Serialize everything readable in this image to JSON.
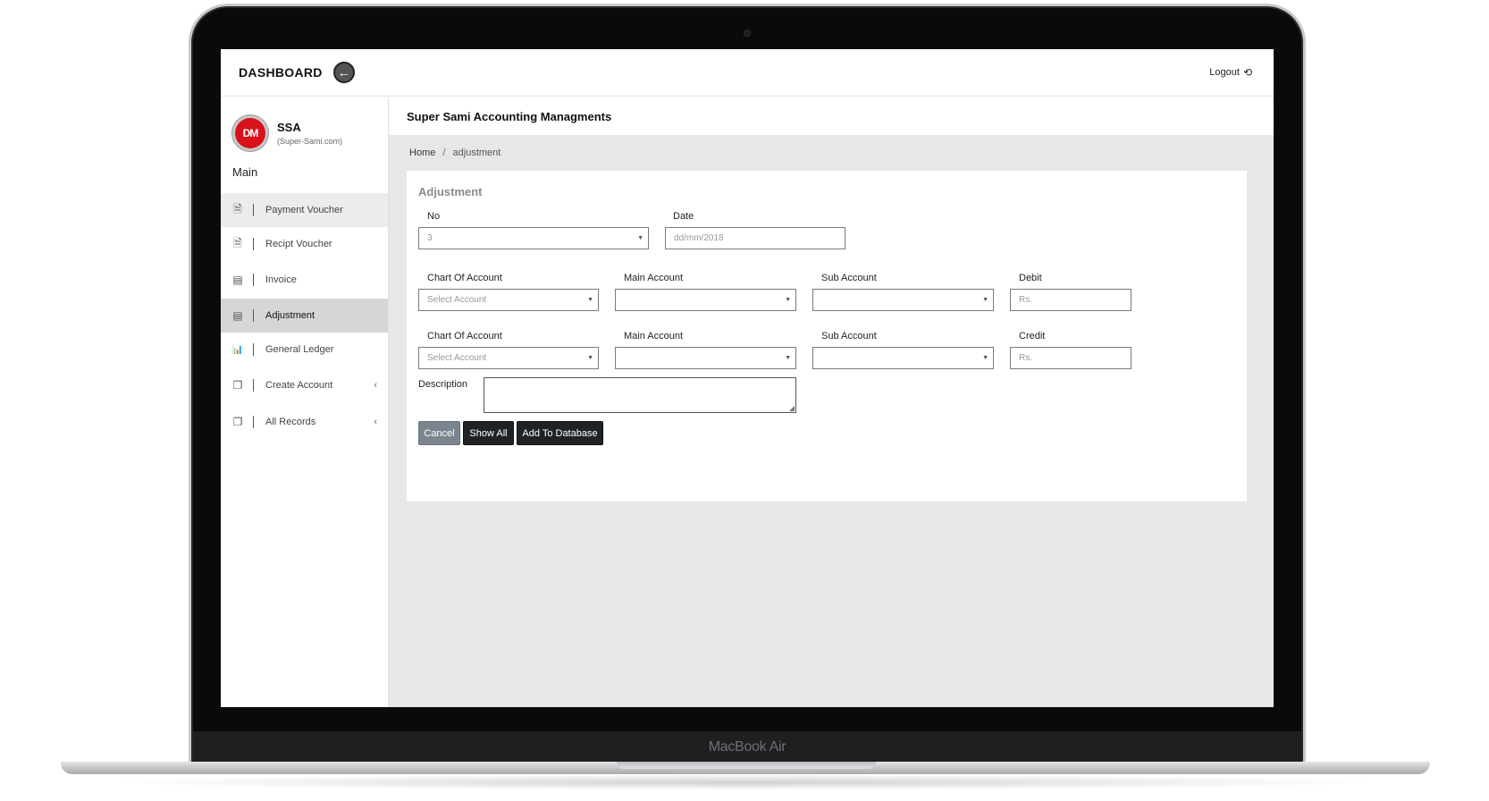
{
  "device": {
    "label": "MacBook Air"
  },
  "topbar": {
    "title": "DASHBOARD",
    "back_icon": "←",
    "logout_label": "Logout",
    "logout_icon": "⟲"
  },
  "profile": {
    "avatar_text": "DM",
    "name": "SSA",
    "subtitle": "(Super-Sami.com)"
  },
  "sidebar": {
    "section_title": "Main",
    "items": [
      {
        "label": "Payment Voucher",
        "icon": "🗎",
        "icon_name": "document-icon",
        "chevron": ""
      },
      {
        "label": "Recipt Voucher",
        "icon": "🗎",
        "icon_name": "document-icon",
        "chevron": ""
      },
      {
        "label": "Invoice",
        "icon": "▤",
        "icon_name": "clipboard-icon",
        "chevron": ""
      },
      {
        "label": "Adjustment",
        "icon": "▤",
        "icon_name": "clipboard-icon",
        "chevron": ""
      },
      {
        "label": "General Ledger",
        "icon": "📊",
        "icon_name": "bar-chart-icon",
        "chevron": ""
      },
      {
        "label": "Create Account",
        "icon": "❐",
        "icon_name": "copy-icon",
        "chevron": "‹"
      },
      {
        "label": "All Records",
        "icon": "❐",
        "icon_name": "copy-icon",
        "chevron": "‹"
      }
    ]
  },
  "content": {
    "header_title": "Super Sami Accounting Managments",
    "breadcrumb": {
      "home": "Home",
      "separator": "/",
      "current": "adjustment"
    }
  },
  "form": {
    "title": "Adjustment",
    "no": {
      "label": "No",
      "value": "3"
    },
    "date": {
      "label": "Date",
      "placeholder": "dd/mm/2018"
    },
    "debit_row": {
      "chart_label": "Chart Of Account",
      "chart_value": "Select Account",
      "main_label": "Main Account",
      "main_value": "",
      "sub_label": "Sub Account",
      "sub_value": "",
      "amount_label": "Debit",
      "amount_placeholder": "Rs."
    },
    "credit_row": {
      "chart_label": "Chart Of Account",
      "chart_value": "Select Account",
      "main_label": "Main Account",
      "main_value": "",
      "sub_label": "Sub Account",
      "sub_value": "",
      "amount_label": "Credit",
      "amount_placeholder": "Rs."
    },
    "description_label": "Description",
    "buttons": {
      "cancel": "Cancel",
      "show_all": "Show All",
      "add": "Add To Database"
    }
  },
  "colors": {
    "accent_red": "#d8121b",
    "dark_button": "#1f2326",
    "gray_button": "#7b858f",
    "content_bg": "#e7e7e8"
  }
}
